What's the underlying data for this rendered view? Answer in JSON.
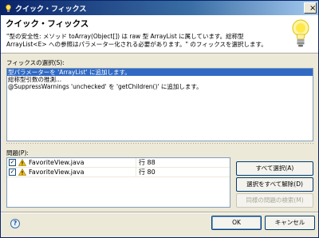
{
  "window": {
    "title": "クイック・フィックス",
    "close_symbol": "×"
  },
  "header": {
    "title": "クイック・フィックス",
    "description": "\"型の安全性: メソッド toArray(Object[]) は raw 型 ArrayList に属しています。総称型 ArrayList<E> への参照はパラメーター化される必要があります。\" のフィックスを選択します。"
  },
  "fixes": {
    "label": "フィックスの選択(S):",
    "items": [
      {
        "label": "型パラメーターを 'ArrayList' に追加します。",
        "selected": true
      },
      {
        "label": "総称型引数の推測...",
        "selected": false
      },
      {
        "label": "@SuppressWarnings 'unchecked' を 'getChildren()' に追加します。",
        "selected": false
      }
    ]
  },
  "problems": {
    "label": "問題(P):",
    "rows": [
      {
        "file": "FavoriteView.java",
        "line": "行 88",
        "checked": true
      },
      {
        "file": "FavoriteView.java",
        "line": "行 80",
        "checked": true
      }
    ],
    "check_mark": "✓"
  },
  "buttons": {
    "select_all": "すべて選択(A)",
    "deselect_all": "選択をすべて解除(D)",
    "find_similar": "同様の問題の検索(M)",
    "ok": "OK",
    "cancel": "キャンセル",
    "help": "?"
  },
  "colors": {
    "selection": "#316ac5",
    "title_bar": "#0a246a",
    "warning": "#f5c211"
  }
}
